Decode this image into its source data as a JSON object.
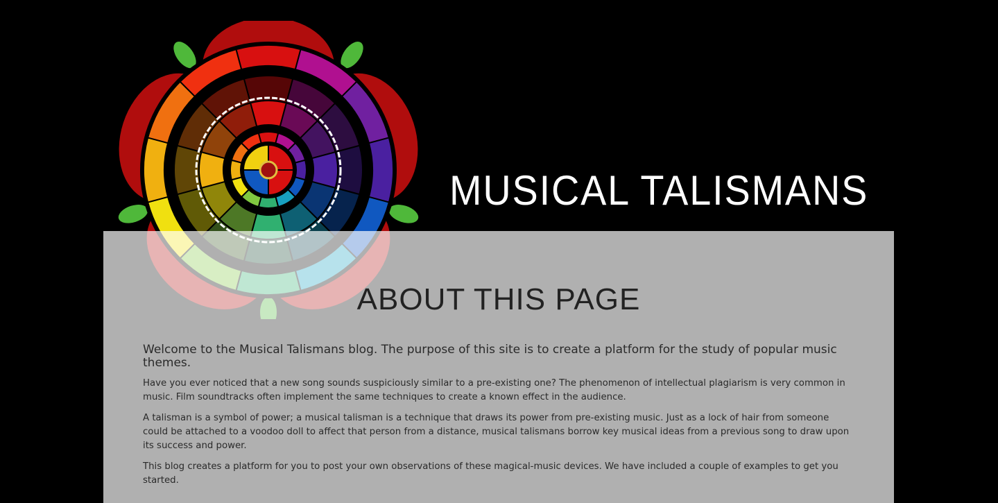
{
  "header": {
    "site_title": "MUSICAL TALISMANS",
    "logo_name": "zodiac-color-wheel-rose-logo"
  },
  "about": {
    "heading": "ABOUT THIS PAGE",
    "intro": "Welcome to the Musical Talismans blog. The purpose of this site is to create a platform for the study of popular music themes.",
    "paragraphs": [
      "Have you ever noticed that a new song sounds suspiciously similar to a pre-existing one? The phenomenon of intellectual plagiarism is very common in music. Film soundtracks often implement the same techniques to create a known effect in the audience.",
      "A talisman is a symbol of power; a musical talisman is a technique that draws its power from pre-existing music. Just as a lock of hair from someone could be attached to a voodoo doll to affect that person from a distance, musical talismans borrow key musical ideas from a previous song to draw upon its success and power.",
      "This blog creates a platform for you to post your own observations of these magical-music devices. We have included a couple of examples to get you started."
    ]
  },
  "colors": {
    "background": "#000000",
    "panel": "#b0b0b0",
    "text": "#2a2a2a",
    "title": "#ffffff"
  }
}
